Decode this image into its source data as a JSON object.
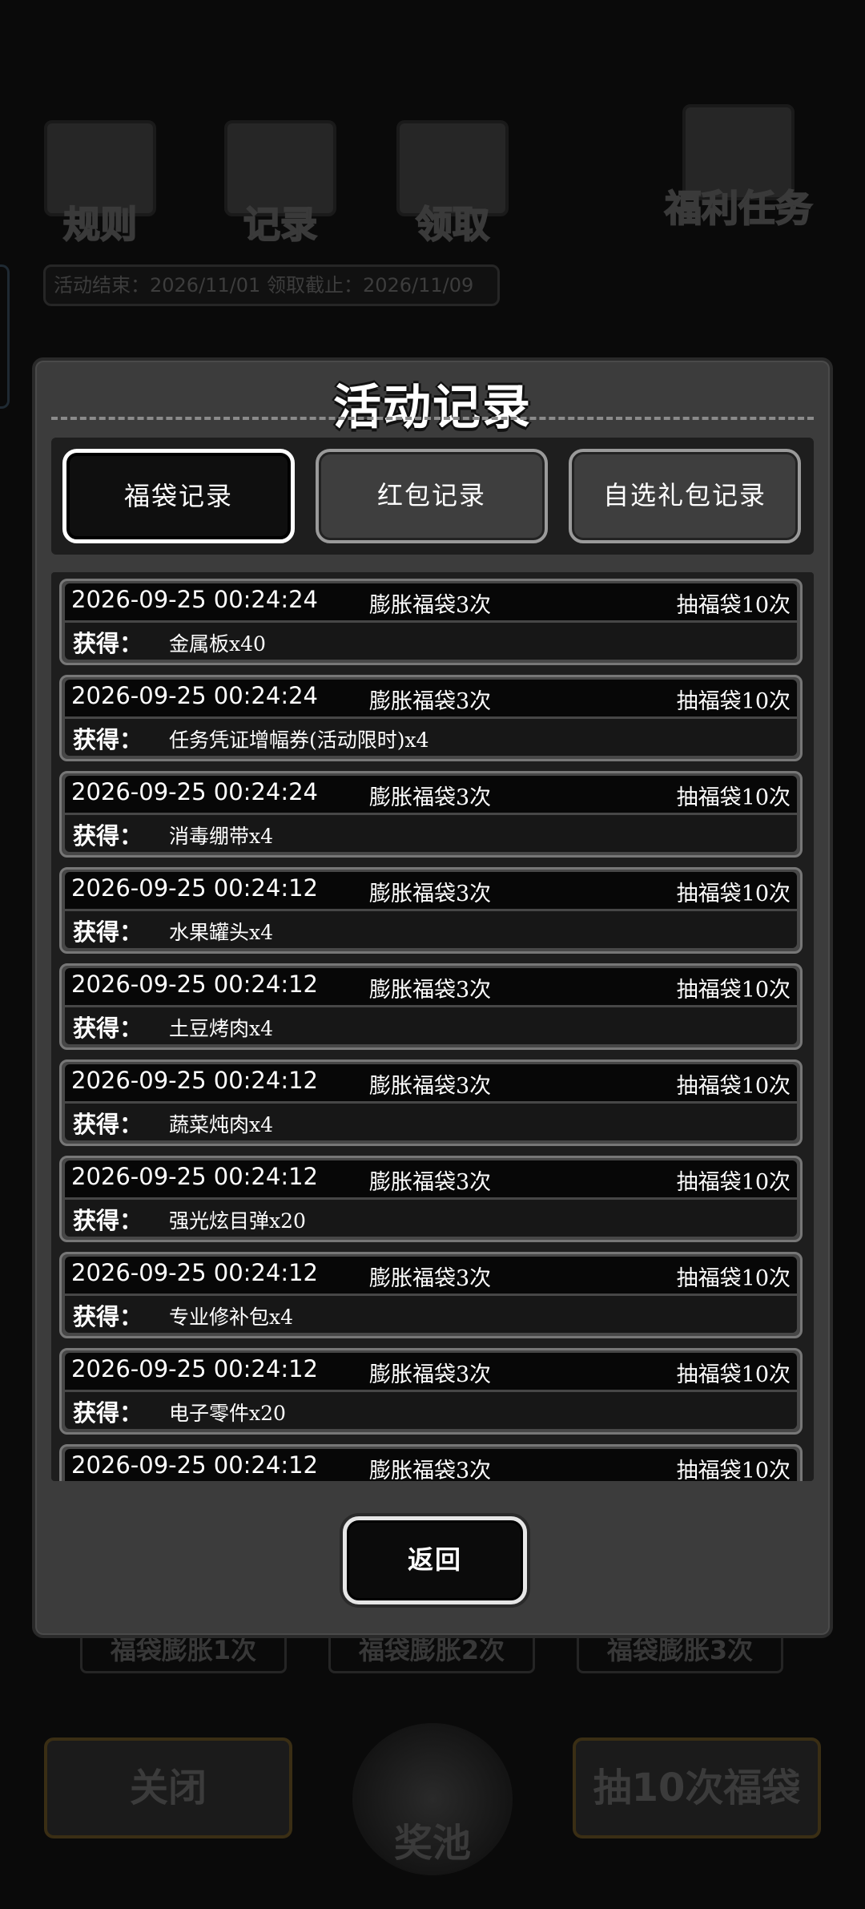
{
  "background": {
    "icons": [
      {
        "name": "rules",
        "label": "规则"
      },
      {
        "name": "records",
        "label": "记录"
      },
      {
        "name": "claim",
        "label": "领取"
      },
      {
        "name": "welfare",
        "label": "福利任务"
      }
    ],
    "date_bar": "活动结束：2026/11/01  领取截止：2026/11/09",
    "tiers": [
      "福袋膨胀1次",
      "福袋膨胀2次",
      "福袋膨胀3次"
    ],
    "close_label": "关闭",
    "pool_label": "奖池",
    "draw10_label": "抽10次福袋"
  },
  "modal": {
    "title": "活动记录",
    "tabs": [
      {
        "label": "福袋记录",
        "active": true
      },
      {
        "label": "红包记录",
        "active": false
      },
      {
        "label": "自选礼包记录",
        "active": false
      }
    ],
    "obtain_label": "获得：",
    "records": [
      {
        "date": "2026-09-25 00:24:24",
        "event": "膨胀福袋3次",
        "draw": "抽福袋10次",
        "reward": "金属板x40"
      },
      {
        "date": "2026-09-25 00:24:24",
        "event": "膨胀福袋3次",
        "draw": "抽福袋10次",
        "reward": "任务凭证增幅券(活动限时)x4"
      },
      {
        "date": "2026-09-25 00:24:24",
        "event": "膨胀福袋3次",
        "draw": "抽福袋10次",
        "reward": "消毒绷带x4"
      },
      {
        "date": "2026-09-25 00:24:12",
        "event": "膨胀福袋3次",
        "draw": "抽福袋10次",
        "reward": "水果罐头x4"
      },
      {
        "date": "2026-09-25 00:24:12",
        "event": "膨胀福袋3次",
        "draw": "抽福袋10次",
        "reward": "土豆烤肉x4"
      },
      {
        "date": "2026-09-25 00:24:12",
        "event": "膨胀福袋3次",
        "draw": "抽福袋10次",
        "reward": "蔬菜炖肉x4"
      },
      {
        "date": "2026-09-25 00:24:12",
        "event": "膨胀福袋3次",
        "draw": "抽福袋10次",
        "reward": "强光炫目弹x20"
      },
      {
        "date": "2026-09-25 00:24:12",
        "event": "膨胀福袋3次",
        "draw": "抽福袋10次",
        "reward": "专业修补包x4"
      },
      {
        "date": "2026-09-25 00:24:12",
        "event": "膨胀福袋3次",
        "draw": "抽福袋10次",
        "reward": "电子零件x20"
      },
      {
        "date": "2026-09-25 00:24:12",
        "event": "膨胀福袋3次",
        "draw": "抽福袋10次",
        "reward": ""
      }
    ],
    "back_label": "返回"
  }
}
